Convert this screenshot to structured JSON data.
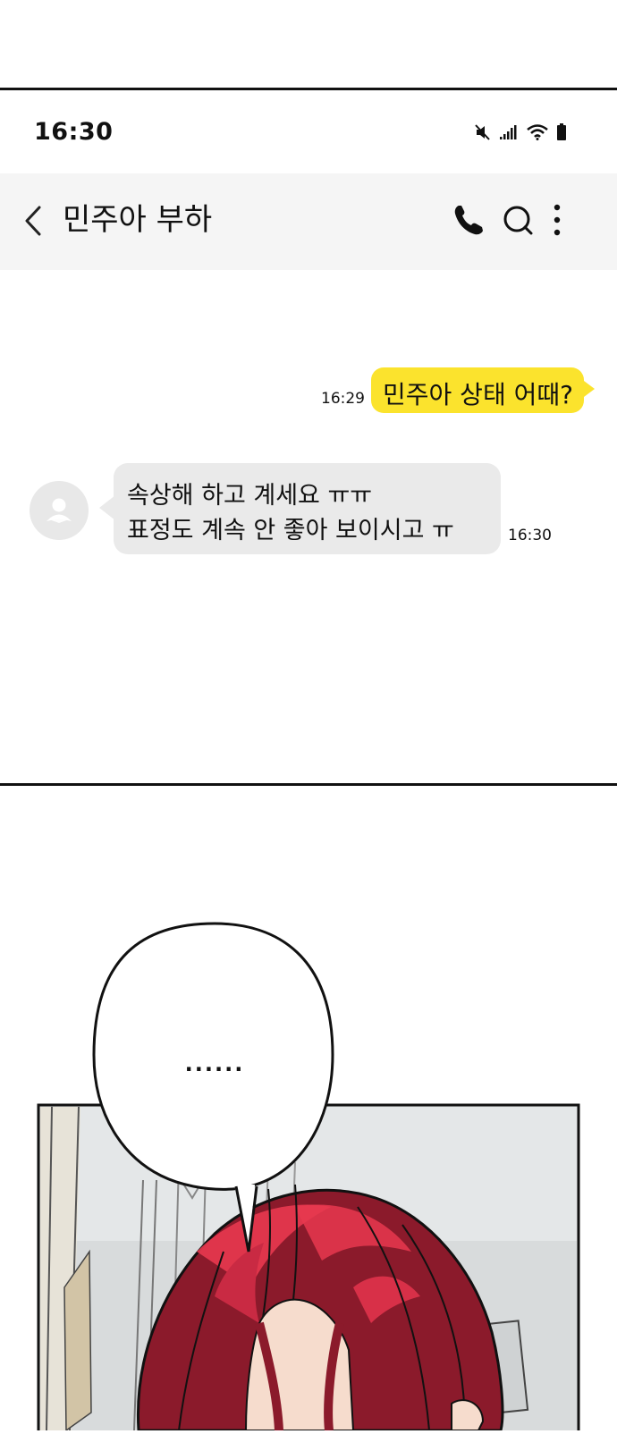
{
  "status_bar": {
    "time": "16:30",
    "icons": [
      "mute-icon",
      "signal-icon",
      "wifi-icon",
      "battery-icon"
    ]
  },
  "app_bar": {
    "title": "민주아 부하",
    "icons": [
      "back-icon",
      "phone-icon",
      "search-icon",
      "more-icon"
    ]
  },
  "messages": [
    {
      "direction": "outgoing",
      "time": "16:29",
      "lines": [
        "민주아 상태 어때?"
      ]
    },
    {
      "direction": "incoming",
      "time": "16:30",
      "lines": [
        "속상해 하고 계세요 ㅠㅠ",
        "표정도 계속 안 좋아 보이시고 ㅠ"
      ]
    }
  ],
  "comic": {
    "speech": "......"
  },
  "colors": {
    "outgoing_bubble": "#fbe32d",
    "incoming_bubble": "#eaeaea",
    "app_bar_bg": "#f5f5f5",
    "hair": "#8b1a2b",
    "hair_highlight": "#e8384f"
  }
}
